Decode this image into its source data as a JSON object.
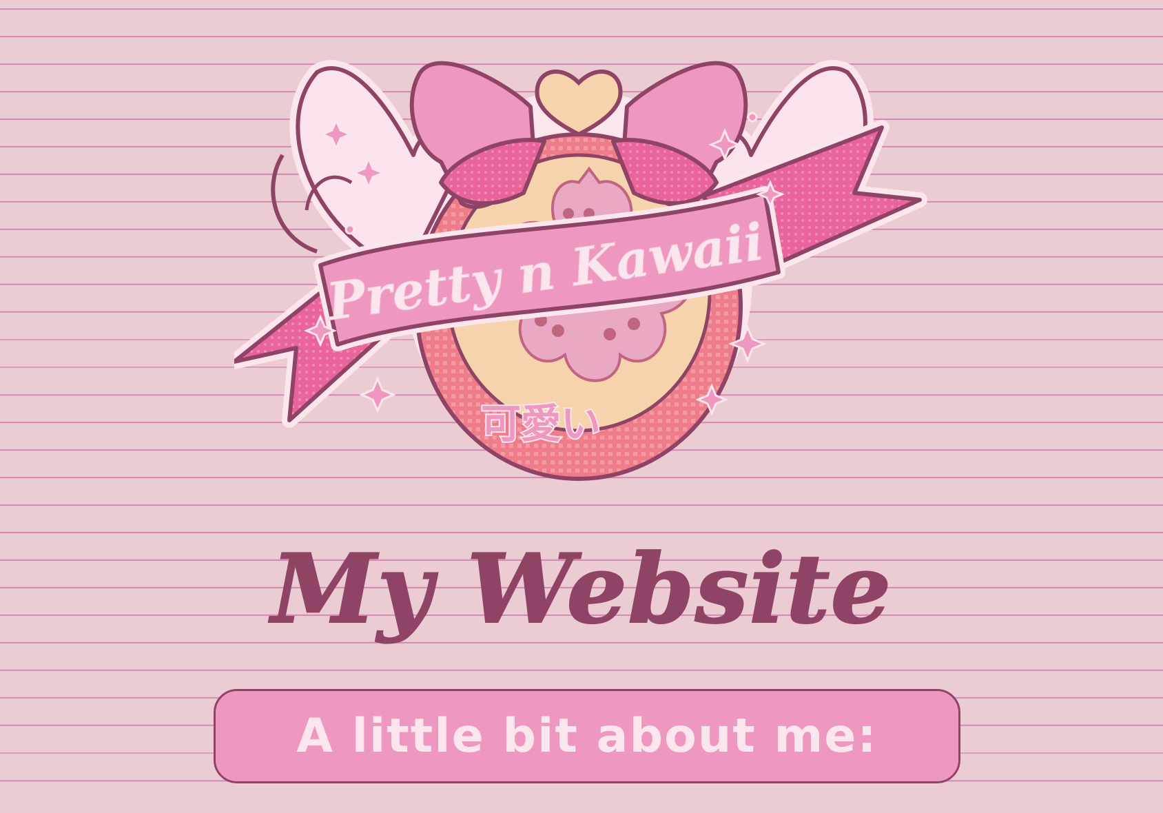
{
  "logo": {
    "banner_text": "Pretty n Kawaii",
    "kanji_text": "可愛い",
    "icon": "kawaii-crest-logo"
  },
  "header": {
    "title": "My Website"
  },
  "about": {
    "heading": "A little bit about me:"
  },
  "colors": {
    "background": "#ecccd3",
    "stripe": "#d488b4",
    "title": "#8f4466",
    "box_fill": "#ee97bf",
    "box_text": "#fbe6ee"
  }
}
